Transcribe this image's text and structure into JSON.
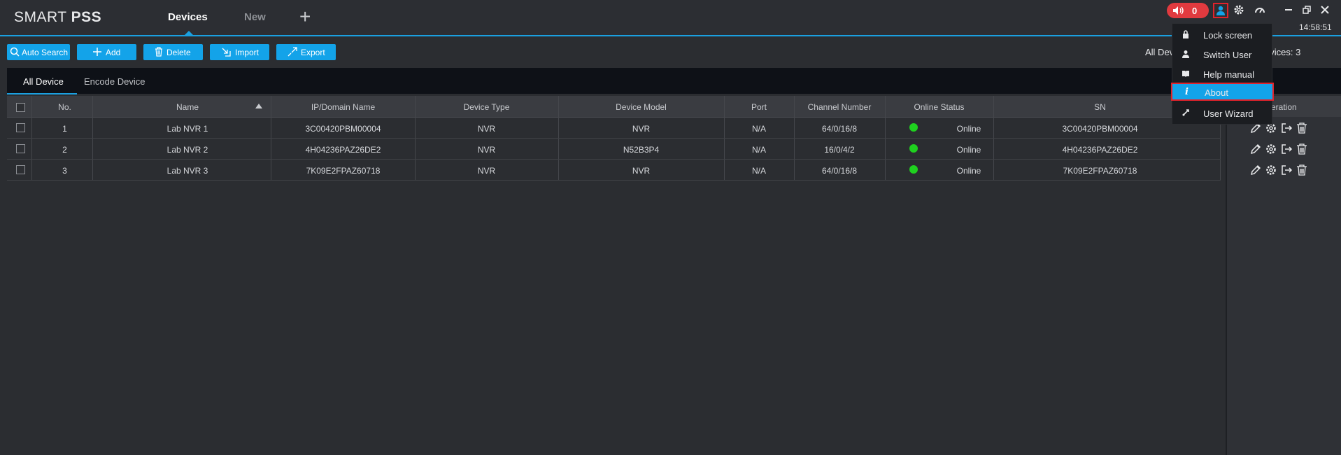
{
  "app": {
    "logo_light": "SMART ",
    "logo_bold": "PSS"
  },
  "top_tabs": {
    "devices": "Devices",
    "new": "New",
    "add": "+"
  },
  "top_bar": {
    "alarm_count": "0",
    "clock": "14:58:51"
  },
  "toolbar": {
    "auto_search": "Auto Search",
    "add": "Add",
    "delete": "Delete",
    "import": "Import",
    "export": "Export",
    "all_devices_label": "All Dev",
    "devices_count_label": "evices:  3"
  },
  "sub_tabs": {
    "all_device": "All Device",
    "encode_device": "Encode Device"
  },
  "table": {
    "columns": {
      "no": "No.",
      "name": "Name",
      "ip": "IP/Domain Name",
      "type": "Device Type",
      "model": "Device Model",
      "port": "Port",
      "channel": "Channel Number",
      "status": "Online Status",
      "sn": "SN",
      "operation": "eration"
    },
    "rows": [
      {
        "no": "1",
        "name": "Lab NVR 1",
        "ip": "3C00420PBM00004",
        "type": "NVR",
        "model": "NVR",
        "port": "N/A",
        "channel": "64/0/16/8",
        "status": "Online",
        "sn": "3C00420PBM00004"
      },
      {
        "no": "2",
        "name": "Lab NVR 2",
        "ip": "4H04236PAZ26DE2",
        "type": "NVR",
        "model": "N52B3P4",
        "port": "N/A",
        "channel": "16/0/4/2",
        "status": "Online",
        "sn": "4H04236PAZ26DE2"
      },
      {
        "no": "3",
        "name": "Lab NVR 3",
        "ip": "7K09E2FPAZ60718",
        "type": "NVR",
        "model": "NVR",
        "port": "N/A",
        "channel": "64/0/16/8",
        "status": "Online",
        "sn": "7K09E2FPAZ60718"
      }
    ]
  },
  "user_menu": {
    "lock_screen": "Lock screen",
    "switch_user": "Switch User",
    "help_manual": "Help manual",
    "about": "About",
    "user_wizard": "User Wizard"
  },
  "colors": {
    "accent": "#13a3e9",
    "alarm": "#e13a3f",
    "highlight_border": "#e0222b",
    "online": "#1fd11f"
  },
  "icons": [
    "speaker-icon",
    "user-icon",
    "gear-icon",
    "speedometer-icon",
    "minimize-icon",
    "restore-icon",
    "close-icon",
    "search-icon",
    "plus-icon",
    "trash-icon",
    "import-icon",
    "export-icon",
    "lock-icon",
    "book-icon",
    "info-icon",
    "wizard-icon",
    "edit-icon",
    "settings-icon",
    "logout-icon",
    "sort-up-icon"
  ]
}
